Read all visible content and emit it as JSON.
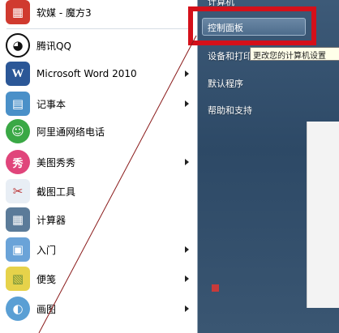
{
  "programs": [
    {
      "label": "软媒 - 魔方3",
      "icon": "rubiks-cube-icon",
      "color": "#d03a2f",
      "glyph": "▦",
      "arrow": false
    },
    {
      "label": "腾讯QQ",
      "icon": "qq-penguin-icon",
      "color": "#1a1a1a",
      "glyph": "◕",
      "arrow": false
    },
    {
      "label": "Microsoft Word 2010",
      "icon": "word-icon",
      "color": "#2b5797",
      "glyph": "W",
      "arrow": true
    },
    {
      "label": "记事本",
      "icon": "notepad-icon",
      "color": "#4a90c8",
      "glyph": "▤",
      "arrow": true
    },
    {
      "label": "阿里通网络电话",
      "icon": "phone-icon",
      "color": "#3aa845",
      "glyph": "☺",
      "arrow": false
    },
    {
      "label": "美图秀秀",
      "icon": "meitu-icon",
      "color": "#e0457b",
      "glyph": "秀",
      "arrow": true
    },
    {
      "label": "截图工具",
      "icon": "scissors-icon",
      "color": "#c8d6e5",
      "glyph": "✂",
      "arrow": false
    },
    {
      "label": "计算器",
      "icon": "calculator-icon",
      "color": "#5b7b99",
      "glyph": "▦",
      "arrow": false
    },
    {
      "label": "入门",
      "icon": "getting-started-icon",
      "color": "#6aa3d8",
      "glyph": "▣",
      "arrow": true
    },
    {
      "label": "便笺",
      "icon": "sticky-note-icon",
      "color": "#e6d24a",
      "glyph": "▧",
      "arrow": true
    },
    {
      "label": "画图",
      "icon": "paint-icon",
      "color": "#5a9fd4",
      "glyph": "◐",
      "arrow": true
    }
  ],
  "right_menu": {
    "computer": "计算机",
    "control_panel": "控制面板",
    "devices": "设备和打印",
    "default_programs": "默认程序",
    "help": "帮助和支持"
  },
  "tooltip": "更改您的计算机设置",
  "annotation_color": "#d4101a"
}
